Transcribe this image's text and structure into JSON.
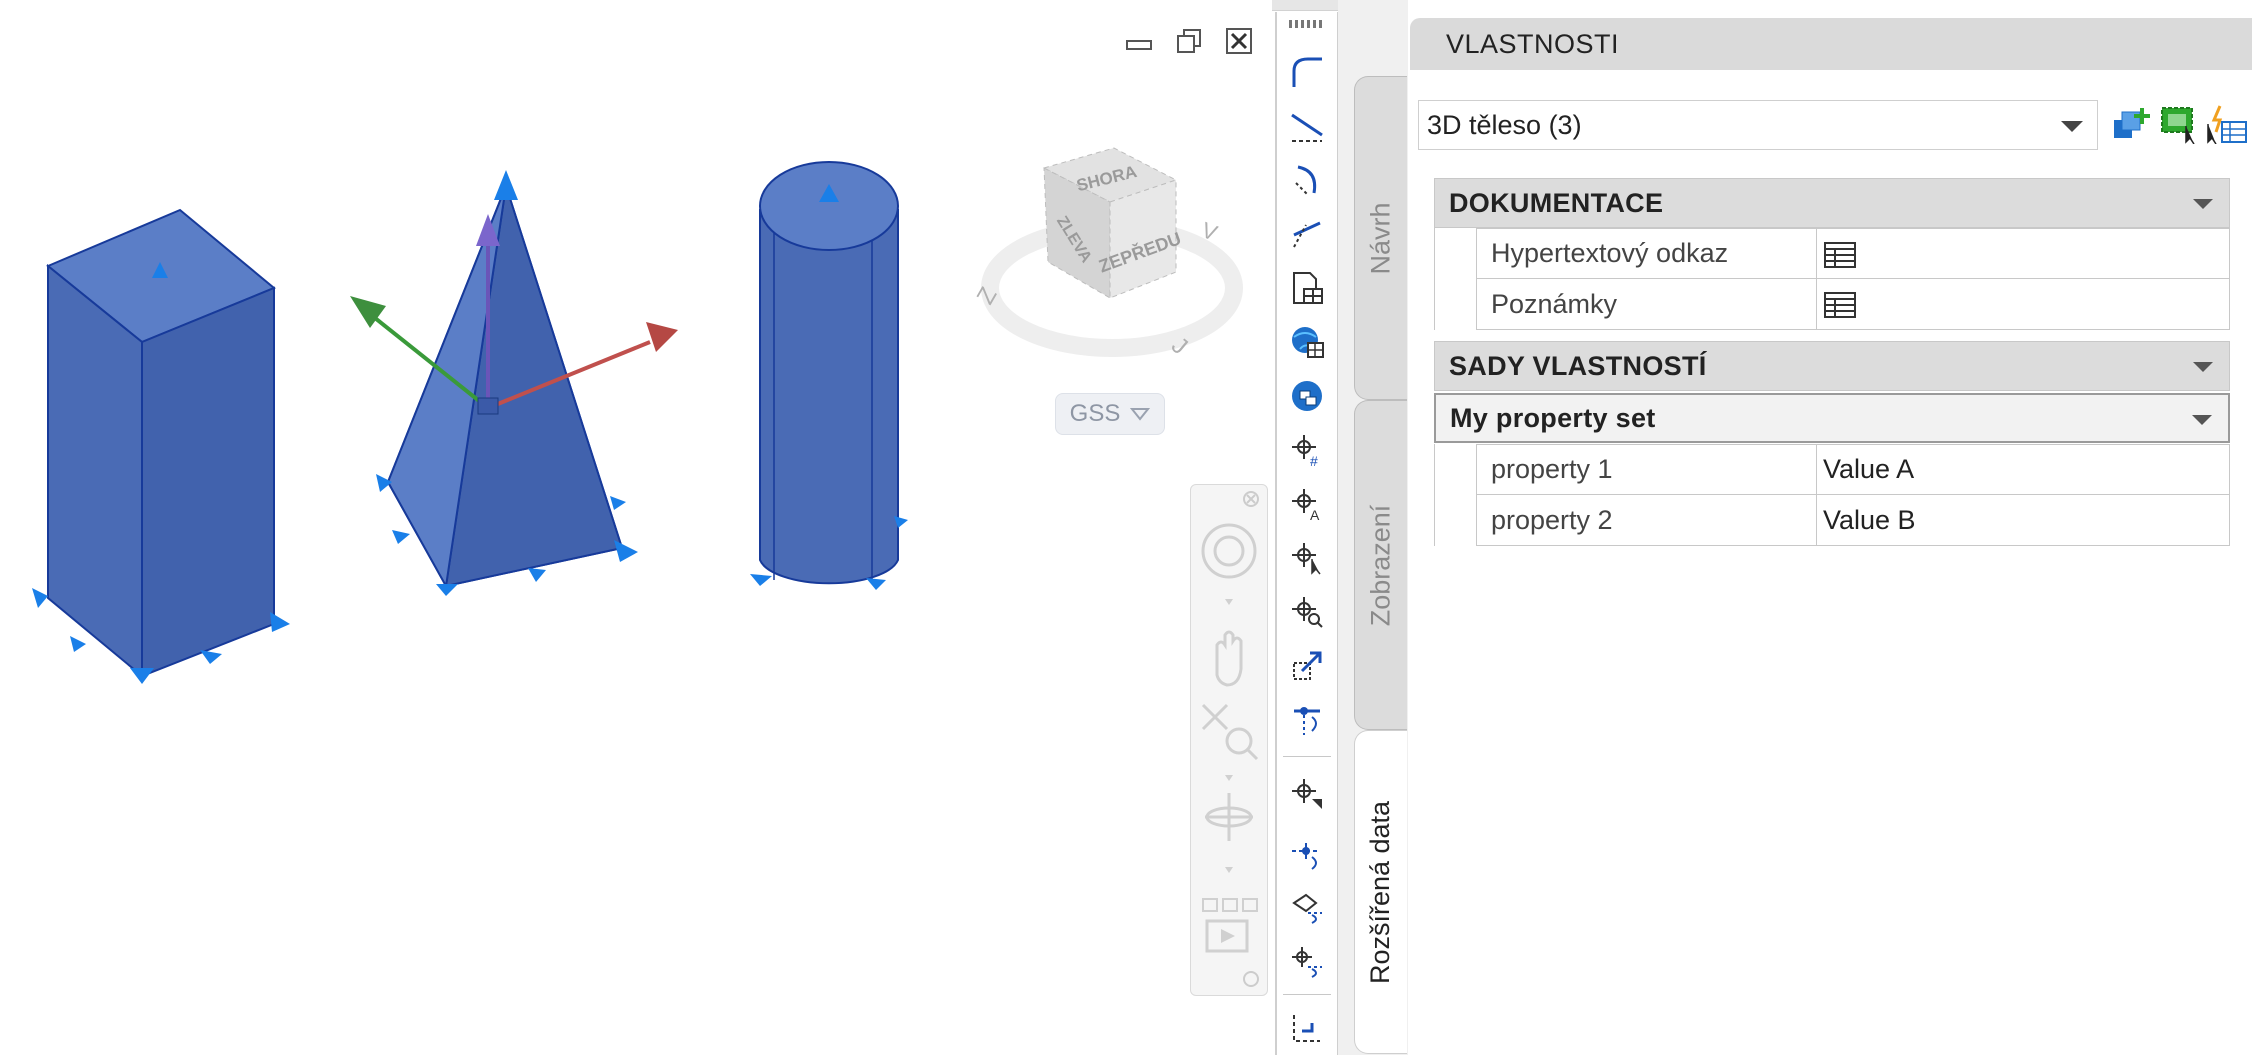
{
  "viewport": {
    "window_controls": [
      "minimize-icon",
      "restore-icon",
      "close-icon"
    ],
    "viewcube": {
      "top": "SHORA",
      "front": "ZEPŘEDU",
      "left": "ZLEVA",
      "compass_s": "J",
      "compass_w": "Z",
      "compass_e": "V"
    },
    "ucs_label": "GSS"
  },
  "palette": {
    "title": "VLASTNOSTI",
    "tabs": [
      {
        "label": "Návrh",
        "active": false
      },
      {
        "label": "Zobrazení",
        "active": false
      },
      {
        "label": "Rozšířená data",
        "active": true
      }
    ],
    "selection": "3D těleso (3)",
    "quick_buttons": [
      "add-to-selection-icon",
      "select-objects-icon",
      "quick-select-icon"
    ],
    "categories": [
      {
        "name": "DOKUMENTACE",
        "rows": [
          {
            "key": "Hypertextový odkaz",
            "value_icon": "table-icon"
          },
          {
            "key": "Poznámky",
            "value_icon": "table-icon"
          }
        ]
      },
      {
        "name": "SADY VLASTNOSTÍ",
        "subcategory": "My property set",
        "rows": [
          {
            "key": "property 1",
            "value": "Value A"
          },
          {
            "key": "property 2",
            "value": "Value B"
          }
        ]
      }
    ]
  },
  "colors": {
    "solid_fill": "#4a6bb5",
    "solid_edge": "#173a9a",
    "grip": "#1a7fe8",
    "palette_bg": "#f0f0f0"
  }
}
